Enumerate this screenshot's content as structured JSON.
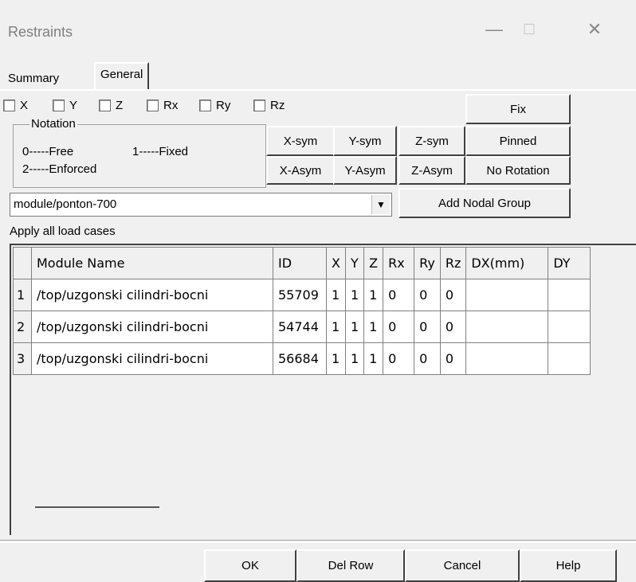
{
  "window": {
    "title": "Restraints",
    "minimize": "—",
    "maximize": "☐",
    "close": "✕"
  },
  "tabs": {
    "summary": "Summary",
    "general": "General"
  },
  "checkboxes": [
    "X",
    "Y",
    "Z",
    "Rx",
    "Ry",
    "Rz"
  ],
  "notation": {
    "title": "Notation",
    "free": "0-----Free",
    "fixed": "1-----Fixed",
    "enforced": "2-----Enforced"
  },
  "buttons": {
    "fix": "Fix",
    "pinned": "Pinned",
    "no_rotation": "No Rotation",
    "xsym": "X-sym",
    "ysym": "Y-sym",
    "zsym": "Z-sym",
    "xasym": "X-Asym",
    "yasym": "Y-Asym",
    "zasym": "Z-Asym",
    "add_nodal_group": "Add Nodal Group"
  },
  "combo": {
    "value": "module/ponton-700"
  },
  "apply_label": "Apply all load cases",
  "grid": {
    "headers": [
      "",
      "Module Name",
      "ID",
      "X",
      "Y",
      "Z",
      "Rx",
      "Ry",
      "Rz",
      "DX(mm)",
      "DY"
    ],
    "rows": [
      [
        "1",
        "/top/uzgonski cilindri-bocni",
        "55709",
        "1",
        "1",
        "1",
        "0",
        "0",
        "0",
        "",
        ""
      ],
      [
        "2",
        "/top/uzgonski cilindri-bocni",
        "54744",
        "1",
        "1",
        "1",
        "0",
        "0",
        "0",
        "",
        ""
      ],
      [
        "3",
        "/top/uzgonski cilindri-bocni",
        "56684",
        "1",
        "1",
        "1",
        "0",
        "0",
        "0",
        "",
        ""
      ]
    ]
  },
  "footer": {
    "ok": "OK",
    "del_row": "Del Row",
    "cancel": "Cancel",
    "help": "Help"
  }
}
